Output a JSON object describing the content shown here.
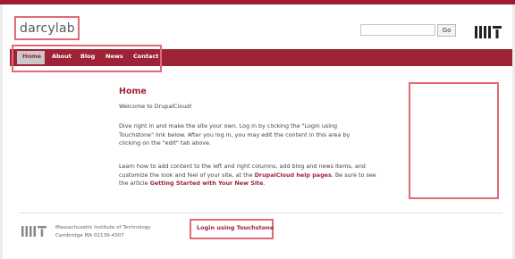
{
  "header": {
    "site_name": "darcylab",
    "search_placeholder": "",
    "go_label": "Go",
    "logo_icon": "mit-logo-icon"
  },
  "nav": {
    "items": [
      {
        "label": "Home",
        "active": true
      },
      {
        "label": "About"
      },
      {
        "label": "Blog"
      },
      {
        "label": "News"
      },
      {
        "label": "Contact"
      }
    ]
  },
  "main": {
    "title": "Home",
    "welcome": "Welcome to DrupalCloud!",
    "p2_line1": "Dive right in and make the site your own. Log in by clicking the \"Login using",
    "p2_line2": "Touchstone\" link below. After you log in, you may edit the content in this area by",
    "p2_line3": "clicking on the \"edit\" tab above.",
    "p3_line1": "Learn how to add content to the left and right columns, add blog and news items, and",
    "p3_line2a": "customize the look and feel of your site, at the ",
    "p3_link1": "DrupalCloud help pages",
    "p3_line2b": ". Be sure to see",
    "p3_line3a": "the article ",
    "p3_link2": "Getting Started with Your New Site",
    "p3_line3b": "."
  },
  "footer": {
    "org": "Massachusetts Institute of Technology",
    "address": "Cambridge MA 02139-4307",
    "login_link": "Login using Touchstone"
  },
  "colors": {
    "brand": "#9e2337",
    "highlight": "#e06b77"
  }
}
